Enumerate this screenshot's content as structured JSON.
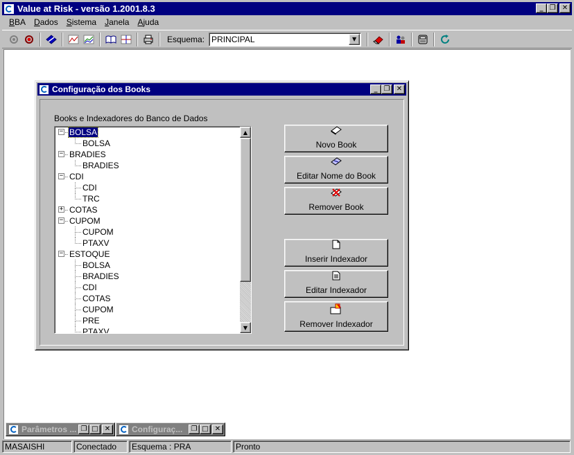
{
  "app": {
    "title": "Value at Risk - versão 1.2001.8.3"
  },
  "window_buttons": {
    "minimize": "_",
    "restore": "❐",
    "close": "✕"
  },
  "menu": [
    {
      "label": "BBA",
      "key": "B",
      "rest": "BA"
    },
    {
      "label": "Dados",
      "key": "D",
      "rest": "ados"
    },
    {
      "label": "Sistema",
      "key": "S",
      "rest": "istema"
    },
    {
      "label": "Janela",
      "key": "J",
      "rest": "anela"
    },
    {
      "label": "Ajuda",
      "key": "A",
      "rest": "juda"
    }
  ],
  "toolbar": {
    "schema_label": "Esquema:",
    "schema_value": "PRINCIPAL",
    "icons": [
      "record-off-icon",
      "record-on-icon",
      "diamond-icon",
      "chart-line-icon",
      "chart-multi-icon",
      "book-open-icon",
      "chart-grid-icon",
      "printer-icon",
      "eraser-icon",
      "users-icon",
      "calculator-icon",
      "refresh-icon"
    ]
  },
  "dialog": {
    "title": "Configuração dos Books",
    "tree_label": "Books e Indexadores do Banco de Dados",
    "tree": [
      {
        "label": "BOLSA",
        "level": 0,
        "expander": "−",
        "selected": true
      },
      {
        "label": "BOLSA",
        "level": 1
      },
      {
        "label": "BRADIES",
        "level": 0,
        "expander": "−"
      },
      {
        "label": "BRADIES",
        "level": 1
      },
      {
        "label": "CDI",
        "level": 0,
        "expander": "−"
      },
      {
        "label": "CDI",
        "level": 1
      },
      {
        "label": "TRC",
        "level": 1
      },
      {
        "label": "COTAS",
        "level": 0,
        "expander": "+"
      },
      {
        "label": "CUPOM",
        "level": 0,
        "expander": "−"
      },
      {
        "label": "CUPOM",
        "level": 1
      },
      {
        "label": "PTAXV",
        "level": 1
      },
      {
        "label": "ESTOQUE",
        "level": 0,
        "expander": "−"
      },
      {
        "label": "BOLSA",
        "level": 1
      },
      {
        "label": "BRADIES",
        "level": 1
      },
      {
        "label": "CDI",
        "level": 1
      },
      {
        "label": "COTAS",
        "level": 1
      },
      {
        "label": "CUPOM",
        "level": 1
      },
      {
        "label": "PRE",
        "level": 1
      },
      {
        "label": "PTAXV",
        "level": 1
      }
    ],
    "buttons": {
      "new_book": "Novo Book",
      "edit_book": "Editar Nome do Book",
      "remove_book": "Remover Book",
      "insert_index": "Inserir Indexador",
      "edit_index": "Editar Indexador",
      "remove_index": "Remover Indexador"
    }
  },
  "minimized": [
    {
      "title": "Parâmetros ..."
    },
    {
      "title": "Configuraç..."
    }
  ],
  "status": {
    "user": "MASAISHI",
    "connection": "Conectado",
    "schema": "Esquema : PRA",
    "state": "Pronto"
  }
}
